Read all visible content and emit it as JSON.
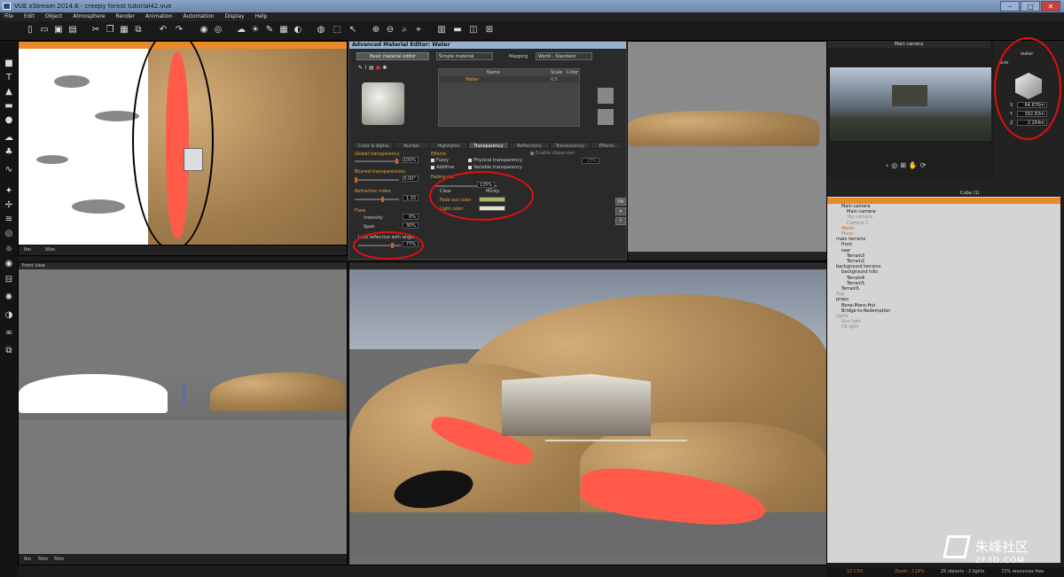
{
  "window": {
    "title": "VUE xStream 2014.6 - creepy forest tutorial42.vue",
    "minimize": "–",
    "maximize": "□",
    "close": "✕"
  },
  "menu": [
    "File",
    "Edit",
    "Object",
    "Atmosphere",
    "Render",
    "Animation",
    "Automation",
    "Display",
    "Help"
  ],
  "viewports": {
    "top": {
      "scale": "50m",
      "zero": "0m"
    },
    "front": {
      "label": "Front view",
      "scale_0": "0m",
      "scale_1": "50m",
      "scale_2": "50m"
    },
    "camera_title": "Main camera"
  },
  "material_editor": {
    "title": "Advanced Material Editor: Water",
    "basic_button": "Basic material editor",
    "material_type": "Simple material",
    "mapping_label": "Mapping",
    "mapping_value": "World - Standard",
    "layers_header": {
      "name": "Name",
      "scale": "Scale",
      "color": "Color"
    },
    "layer_row": {
      "name": "Water",
      "scale": "0.5"
    },
    "tabs": [
      "Color & Alpha",
      "Bumps",
      "Highlights",
      "Transparency",
      "Reflections",
      "Translucency",
      "Effects"
    ],
    "global_transparency": {
      "label": "Global transparency",
      "value": "100%"
    },
    "blurred_transparencies": {
      "label": "Blurred transparencies",
      "value": "0.00°"
    },
    "refraction_index": {
      "label": "Refraction index",
      "value": "1.33"
    },
    "flare": {
      "label": "Flare",
      "intensity_label": "Intensity",
      "intensity_value": "0%",
      "span_label": "Span",
      "span_value": "30%"
    },
    "effects": {
      "label": "Effects",
      "fuzzy": "Fuzzy",
      "additive": "Additive",
      "physical": "Physical transparency",
      "variable": "Variable transparency",
      "enable_dispersion": "Enable dispersion",
      "dispersion_value": "25%"
    },
    "fading_out": {
      "label": "Fading out",
      "value": "135%",
      "clear": "Clear",
      "murky": "Murky"
    },
    "fade_out_color": {
      "label": "Fade out color",
      "color": "#a9b56e"
    },
    "light_color": {
      "label": "Light color",
      "color": "#e8e2cc"
    },
    "less_reflective": {
      "label": "Less reflective with angle",
      "value": "77%"
    },
    "side_buttons": [
      "OK",
      "✕",
      "?"
    ]
  },
  "object_panel": {
    "object_name": "water",
    "size_label": "Size",
    "x_label": "X",
    "x_value": "64.676m",
    "y_label": "Y",
    "y_value": "392.83m",
    "z_label": "Z",
    "z_value": "2.264m",
    "tree_header": "Cube (1)"
  },
  "tree": [
    {
      "text": "Main camera",
      "indent": 1,
      "style": "normal"
    },
    {
      "text": "Main camera",
      "indent": 2,
      "style": "normal"
    },
    {
      "text": "Top camera",
      "indent": 2,
      "style": "faded"
    },
    {
      "text": "Camera 1",
      "indent": 2,
      "style": "faded"
    },
    {
      "text": "Water",
      "indent": 1,
      "style": "orange"
    },
    {
      "text": "Moon",
      "indent": 1,
      "style": "faded"
    },
    {
      "text": "main terrains",
      "indent": 0,
      "style": "normal"
    },
    {
      "text": "front",
      "indent": 1,
      "style": "normal"
    },
    {
      "text": "rear",
      "indent": 1,
      "style": "normal"
    },
    {
      "text": "Terrain3",
      "indent": 2,
      "style": "normal"
    },
    {
      "text": "Terrain2",
      "indent": 2,
      "style": "normal"
    },
    {
      "text": "background terrains",
      "indent": 0,
      "style": "normal"
    },
    {
      "text": "background hills",
      "indent": 1,
      "style": "normal"
    },
    {
      "text": "Terrain4",
      "indent": 2,
      "style": "normal"
    },
    {
      "text": "Terrain5",
      "indent": 2,
      "style": "normal"
    },
    {
      "text": "Terrain5",
      "indent": 1,
      "style": "normal"
    },
    {
      "text": "Fog",
      "indent": 0,
      "style": "faded"
    },
    {
      "text": "props",
      "indent": 0,
      "style": "normal"
    },
    {
      "text": "Bone-Mans-Hut",
      "indent": 1,
      "style": "normal"
    },
    {
      "text": "Bridge-to-Redemption",
      "indent": 1,
      "style": "normal"
    },
    {
      "text": "lights",
      "indent": 0,
      "style": "faded"
    },
    {
      "text": "Sun light",
      "indent": 1,
      "style": "faded"
    },
    {
      "text": "Fill light",
      "indent": 1,
      "style": "faded"
    }
  ],
  "status": {
    "cpu": "12 CPU",
    "zoom": "Zoom : 114%",
    "objects": "25 objects - 2 lights",
    "resources": "72% resources free"
  },
  "watermark": {
    "brand": "朱峰社区",
    "url": "ZF3D.COM"
  },
  "colors": {
    "accent": "#e88a2a",
    "annotation": "#e01010",
    "water": "#ff5a4a"
  }
}
